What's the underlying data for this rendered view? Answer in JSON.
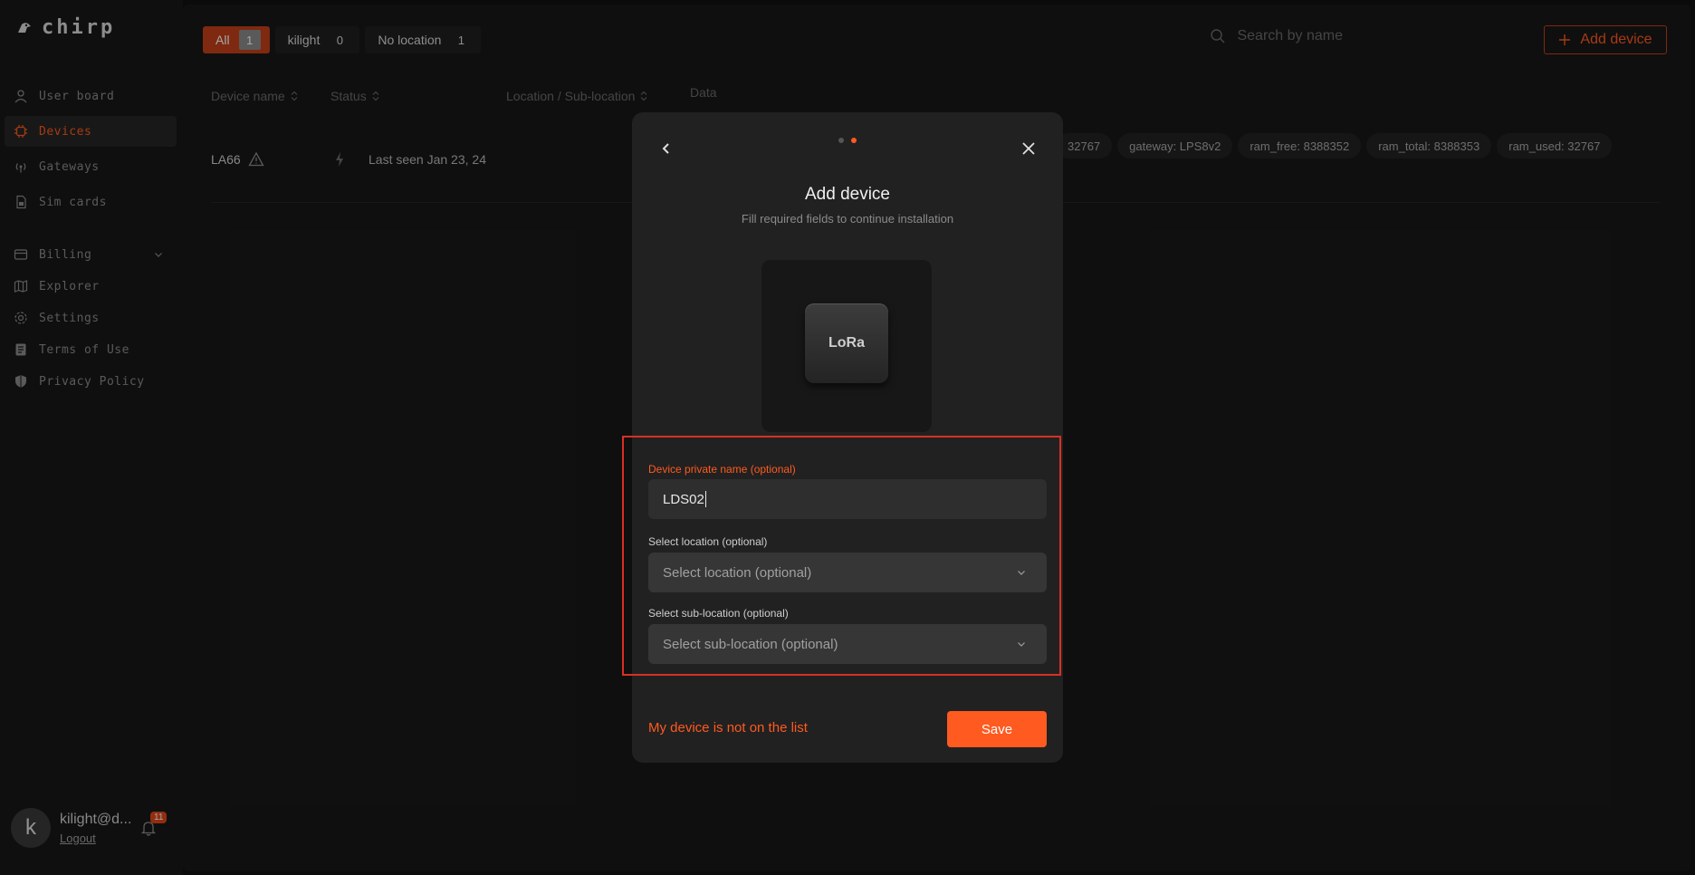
{
  "app": {
    "logo_text": "chirp"
  },
  "sidebar": {
    "items": [
      {
        "label": "User board",
        "icon": "user-icon"
      },
      {
        "label": "Devices",
        "icon": "chip-icon",
        "active": true
      },
      {
        "label": "Gateways",
        "icon": "antenna-icon"
      },
      {
        "label": "Sim cards",
        "icon": "sim-icon"
      },
      {
        "label": "Billing",
        "icon": "billing-icon"
      },
      {
        "label": "Explorer",
        "icon": "map-icon"
      },
      {
        "label": "Settings",
        "icon": "gear-icon"
      },
      {
        "label": "Terms of Use",
        "icon": "document-icon"
      },
      {
        "label": "Privacy Policy",
        "icon": "shield-icon"
      }
    ],
    "user": {
      "avatar_letter": "k",
      "email": "kilight@d...",
      "logout": "Logout",
      "notifications": "11"
    }
  },
  "toolbar": {
    "filters": [
      {
        "label": "All",
        "count": "1"
      },
      {
        "label": "kilight",
        "count": "0"
      },
      {
        "label": "No location",
        "count": "1"
      }
    ],
    "search_placeholder": "Search by name",
    "add_device": "Add device"
  },
  "table": {
    "headers": {
      "name": "Device name",
      "status": "Status",
      "location": "Location / Sub-location",
      "data": "Data"
    },
    "rows": [
      {
        "name": "LA66",
        "status": "Last seen Jan 23, 24",
        "tags": [
          "32767",
          "gateway: LPS8v2",
          "ram_free: 8388352",
          "ram_total: 8388353",
          "ram_used: 32767"
        ]
      }
    ]
  },
  "modal": {
    "title": "Add device",
    "subtitle": "Fill required fields to continue installation",
    "device_image_label": "LoRa",
    "name_label": "Device private name (optional)",
    "name_value": "LDS02",
    "location_label": "Select location (optional)",
    "location_placeholder": "Select location (optional)",
    "sublocation_label": "Select sub-location (optional)",
    "sublocation_placeholder": "Select sub-location (optional)",
    "not_listed": "My device is not on the list",
    "save": "Save"
  },
  "colors": {
    "accent": "#ff5a1f",
    "highlight": "#d93025",
    "background": "#111111"
  }
}
